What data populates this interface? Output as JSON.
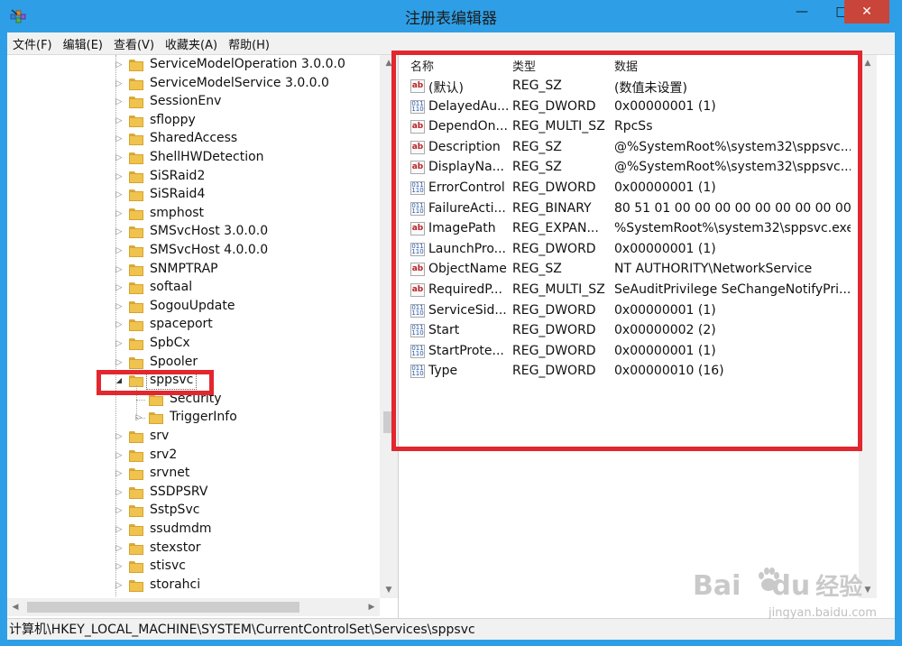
{
  "window": {
    "title": "注册表编辑器",
    "minimize": "—",
    "maximize": "□",
    "close": "✕"
  },
  "menu": [
    "文件(F)",
    "编辑(E)",
    "查看(V)",
    "收藏夹(A)",
    "帮助(H)"
  ],
  "tree": [
    {
      "label": "ServiceModelOperation 3.0.0.0",
      "expander": "▷"
    },
    {
      "label": "ServiceModelService 3.0.0.0",
      "expander": "▷"
    },
    {
      "label": "SessionEnv",
      "expander": "▷"
    },
    {
      "label": "sfloppy",
      "expander": "▷"
    },
    {
      "label": "SharedAccess",
      "expander": "▷"
    },
    {
      "label": "ShellHWDetection",
      "expander": "▷"
    },
    {
      "label": "SiSRaid2",
      "expander": "▷"
    },
    {
      "label": "SiSRaid4",
      "expander": "▷"
    },
    {
      "label": "smphost",
      "expander": "▷"
    },
    {
      "label": "SMSvcHost 3.0.0.0",
      "expander": "▷"
    },
    {
      "label": "SMSvcHost 4.0.0.0",
      "expander": "▷"
    },
    {
      "label": "SNMPTRAP",
      "expander": "▷"
    },
    {
      "label": "softaal",
      "expander": "▷"
    },
    {
      "label": "SogouUpdate",
      "expander": "▷"
    },
    {
      "label": "spaceport",
      "expander": "▷"
    },
    {
      "label": "SpbCx",
      "expander": "▷"
    },
    {
      "label": "Spooler",
      "expander": "▷"
    },
    {
      "label": "sppsvc",
      "expander": "◢",
      "selected": true
    },
    {
      "label": "Security",
      "expander": "",
      "child": true
    },
    {
      "label": "TriggerInfo",
      "expander": "▷",
      "child": true
    },
    {
      "label": "srv",
      "expander": "▷"
    },
    {
      "label": "srv2",
      "expander": "▷"
    },
    {
      "label": "srvnet",
      "expander": "▷"
    },
    {
      "label": "SSDPSRV",
      "expander": "▷"
    },
    {
      "label": "SstpSvc",
      "expander": "▷"
    },
    {
      "label": "ssudmdm",
      "expander": "▷"
    },
    {
      "label": "stexstor",
      "expander": "▷"
    },
    {
      "label": "stisvc",
      "expander": "▷"
    },
    {
      "label": "storahci",
      "expander": "▷"
    }
  ],
  "columns": [
    "名称",
    "类型",
    "数据"
  ],
  "values": [
    {
      "icon": "sz",
      "name": "(默认)",
      "type": "REG_SZ",
      "data": "(数值未设置)"
    },
    {
      "icon": "bin",
      "name": "DelayedAu...",
      "type": "REG_DWORD",
      "data": "0x00000001 (1)"
    },
    {
      "icon": "sz",
      "name": "DependOn...",
      "type": "REG_MULTI_SZ",
      "data": "RpcSs"
    },
    {
      "icon": "sz",
      "name": "Description",
      "type": "REG_SZ",
      "data": "@%SystemRoot%\\system32\\sppsvc..."
    },
    {
      "icon": "sz",
      "name": "DisplayNa...",
      "type": "REG_SZ",
      "data": "@%SystemRoot%\\system32\\sppsvc..."
    },
    {
      "icon": "bin",
      "name": "ErrorControl",
      "type": "REG_DWORD",
      "data": "0x00000001 (1)"
    },
    {
      "icon": "bin",
      "name": "FailureActi...",
      "type": "REG_BINARY",
      "data": "80 51 01 00 00 00 00 00 00 00 00 00 ..."
    },
    {
      "icon": "sz",
      "name": "ImagePath",
      "type": "REG_EXPAN...",
      "data": "%SystemRoot%\\system32\\sppsvc.exe"
    },
    {
      "icon": "bin",
      "name": "LaunchPro...",
      "type": "REG_DWORD",
      "data": "0x00000001 (1)"
    },
    {
      "icon": "sz",
      "name": "ObjectName",
      "type": "REG_SZ",
      "data": "NT AUTHORITY\\NetworkService"
    },
    {
      "icon": "sz",
      "name": "RequiredP...",
      "type": "REG_MULTI_SZ",
      "data": "SeAuditPrivilege SeChangeNotifyPri..."
    },
    {
      "icon": "bin",
      "name": "ServiceSid...",
      "type": "REG_DWORD",
      "data": "0x00000001 (1)"
    },
    {
      "icon": "bin",
      "name": "Start",
      "type": "REG_DWORD",
      "data": "0x00000002 (2)"
    },
    {
      "icon": "bin",
      "name": "StartProte...",
      "type": "REG_DWORD",
      "data": "0x00000001 (1)"
    },
    {
      "icon": "bin",
      "name": "Type",
      "type": "REG_DWORD",
      "data": "0x00000010 (16)"
    }
  ],
  "status": "计算机\\HKEY_LOCAL_MACHINE\\SYSTEM\\CurrentControlSet\\Services\\sppsvc",
  "watermark": {
    "brand": "Bai",
    "brand2": "du",
    "cn": "经验",
    "url": "jingyan.baidu.com"
  },
  "colors": {
    "title_bar": "#2e9fe6",
    "close_button": "#c9453a",
    "highlight": "#e2272f",
    "folder": "#f0c24e"
  }
}
